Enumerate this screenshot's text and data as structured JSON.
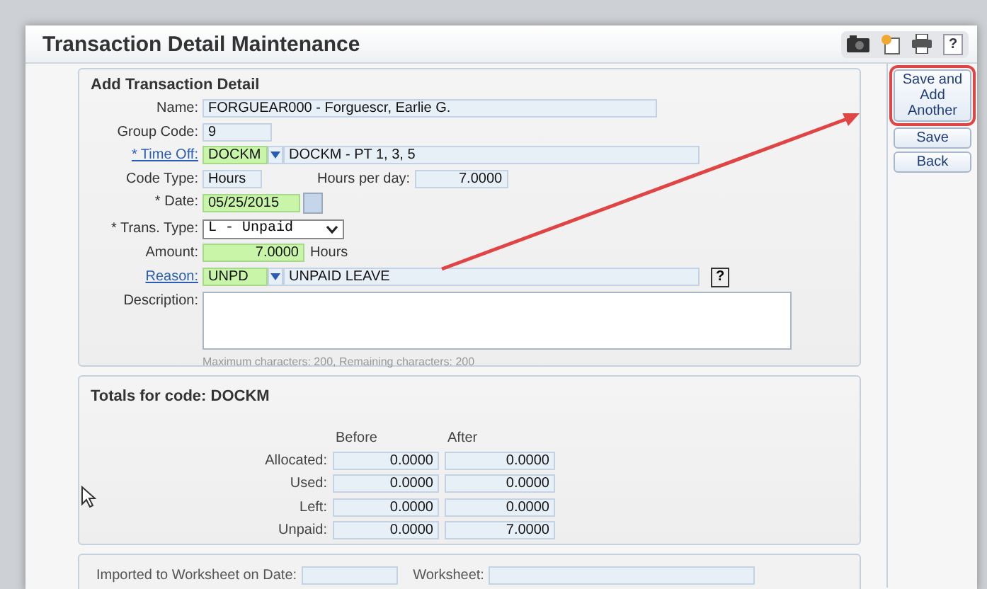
{
  "window": {
    "title": "Transaction Detail Maintenance"
  },
  "toolbar": {
    "help_label": "?"
  },
  "detail": {
    "title": "Add Transaction Detail",
    "fields": [
      {
        "kind": "text",
        "label": "Name:",
        "link": false,
        "value": "FORGUEAR000 - Forguescr, Earlie G.",
        "highlighted": false
      },
      {
        "kind": "text",
        "label": "Group Code:",
        "link": false,
        "value": "9",
        "highlighted": false
      },
      {
        "kind": "lookup",
        "label": "* Time Off:",
        "link": true,
        "value": "DOCKM",
        "description": "DOCKM - PT 1, 3, 5",
        "highlighted": true
      },
      {
        "kind": "pair",
        "label": "Code Type:",
        "link": false,
        "value": "Hours",
        "second_label": "Hours per day:",
        "second_value": "7.0000",
        "highlighted": false
      },
      {
        "kind": "date",
        "label": "* Date:",
        "link": false,
        "value": "05/25/2015",
        "highlighted": true
      },
      {
        "kind": "select",
        "label": "* Trans. Type:",
        "link": false,
        "value": "L - Unpaid",
        "highlighted": false
      },
      {
        "kind": "amount",
        "label": "Amount:",
        "link": false,
        "value": "7.0000",
        "unit": "Hours",
        "highlighted": true
      },
      {
        "kind": "lookup",
        "label": "Reason:",
        "link": true,
        "value": "UNPD",
        "description": "UNPAID LEAVE",
        "help": "?",
        "highlighted": true
      },
      {
        "kind": "textarea",
        "label": "Description:",
        "link": false,
        "hint": "Maximum characters: 200, Remaining characters: 200",
        "highlighted": false
      }
    ]
  },
  "totals": {
    "title": "Totals for code: DOCKM",
    "columns": [
      "Before",
      "After"
    ],
    "rows": [
      {
        "label": "Allocated:",
        "before": "0.0000",
        "after": "0.0000"
      },
      {
        "label": "Used:",
        "before": "0.0000",
        "after": "0.0000"
      },
      {
        "label": "Left:",
        "before": "0.0000",
        "after": "0.0000"
      },
      {
        "label": "Unpaid:",
        "before": "0.0000",
        "after": "7.0000"
      }
    ]
  },
  "footer": {
    "fields": [
      {
        "label": "Imported to Worksheet on Date:"
      },
      {
        "label": "Worksheet:"
      }
    ]
  },
  "actions": [
    {
      "label": "Save and Add Another",
      "highlighted": true
    },
    {
      "label": "Save",
      "highlighted": false
    },
    {
      "label": "Back",
      "highlighted": false
    }
  ]
}
